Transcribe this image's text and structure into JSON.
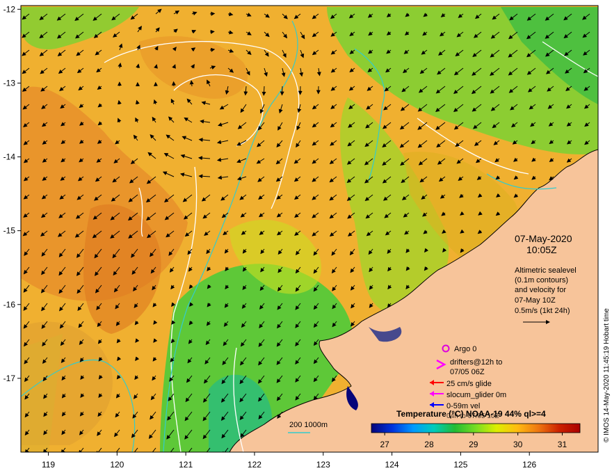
{
  "map": {
    "lon_ticks": [
      "119",
      "120",
      "121",
      "122",
      "123",
      "124",
      "125",
      "126"
    ],
    "lat_ticks": [
      "-12",
      "-13",
      "-14",
      "-15",
      "-16",
      "-17"
    ],
    "lon_range": [
      118.6,
      127.0
    ],
    "lat_range": [
      -18.0,
      -11.95
    ]
  },
  "info": {
    "date": "07-May-2020",
    "time": "10:05Z",
    "altimetry_lines": [
      "Altimetric sealevel",
      "(0.1m contours)",
      "and velocity for",
      "07-May 10Z",
      "0.5m/s (1kt 24h)"
    ]
  },
  "legend": {
    "argo": "Argo 0",
    "drifters_line1": "drifters@12h to",
    "drifters_line2": "07/05 06Z",
    "glide": "25 cm/s glide",
    "glider": "slocum_glider 0m",
    "vel": "0-59m vel",
    "vel2": "04h to 07/05 10Z",
    "depth": "200  1000m"
  },
  "colorbar": {
    "title": "Temperature (°C) NOAA-19 44% ql>=4",
    "ticks": [
      "27",
      "28",
      "29",
      "30",
      "31"
    ],
    "range": [
      26.7,
      31.4
    ],
    "colors": [
      "#05057a",
      "#0033dd",
      "#0099ff",
      "#00ccbb",
      "#22bb33",
      "#77dd22",
      "#ddee00",
      "#ffbb11",
      "#ee7711",
      "#cc2200",
      "#aa0000"
    ]
  },
  "credit": "© IMOS 14-May-2020 11:45:19 Hobart time",
  "colors": {
    "land": "#f7c49a",
    "sst_base": "#f0b030",
    "sst_green": "#4ecb3a",
    "contour": "#ffffff",
    "isobath": "#33cccc"
  }
}
